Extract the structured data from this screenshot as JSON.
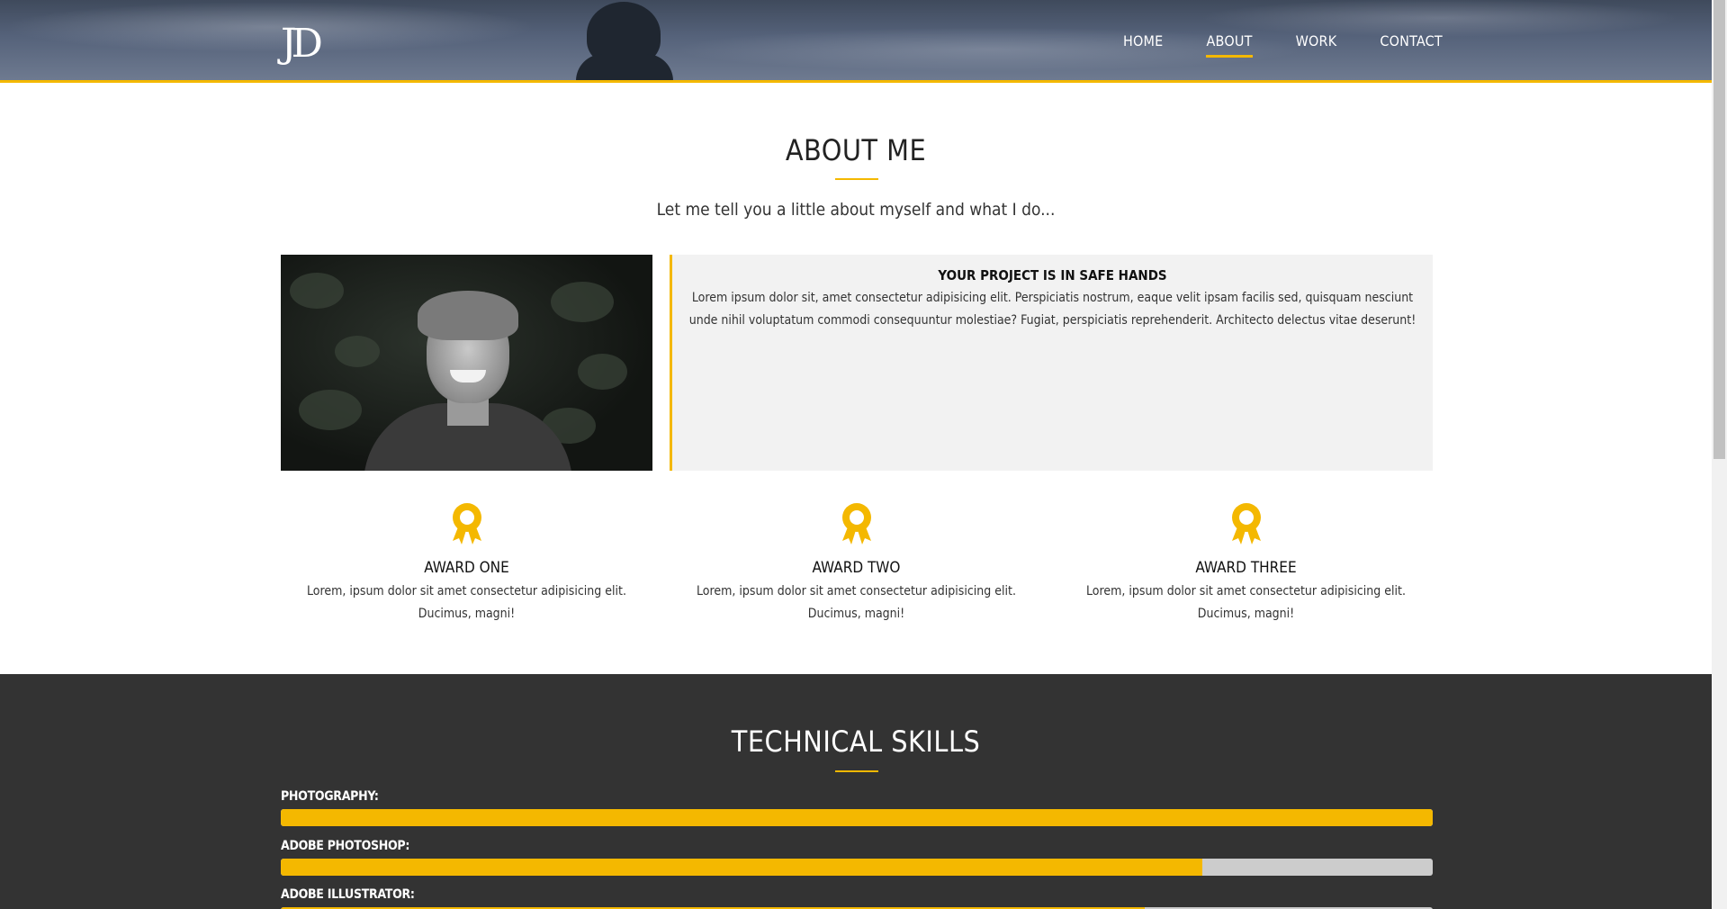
{
  "header": {
    "logo": "JD",
    "nav": [
      {
        "label": "HOME",
        "active": false
      },
      {
        "label": "ABOUT",
        "active": true
      },
      {
        "label": "WORK",
        "active": false
      },
      {
        "label": "CONTACT",
        "active": false
      }
    ]
  },
  "about": {
    "title": "ABOUT ME",
    "subtitle": "Let me tell you a little about myself and what I do...",
    "info_title": "YOUR PROJECT IS IN SAFE HANDS",
    "info_text": "Lorem ipsum dolor sit, amet consectetur adipisicing elit. Perspiciatis nostrum, eaque velit ipsam facilis sed, quisquam nesciunt unde nihil voluptatum commodi consequuntur molestiae? Fugiat, perspiciatis reprehenderit. Architecto delectus vitae deserunt!"
  },
  "awards": [
    {
      "title": "AWARD ONE",
      "text": "Lorem, ipsum dolor sit amet consectetur adipisicing elit. Ducimus, magni!",
      "icon": "award-ribbon-icon"
    },
    {
      "title": "AWARD TWO",
      "text": "Lorem, ipsum dolor sit amet consectetur adipisicing elit. Ducimus, magni!",
      "icon": "award-ribbon-icon"
    },
    {
      "title": "AWARD THREE",
      "text": "Lorem, ipsum dolor sit amet consectetur adipisicing elit. Ducimus, magni!",
      "icon": "award-ribbon-icon"
    }
  ],
  "skills": {
    "title": "TECHNICAL SKILLS",
    "items": [
      {
        "label": "PHOTOGRAPHY:",
        "percent": 100
      },
      {
        "label": "ADOBE PHOTOSHOP:",
        "percent": 80
      },
      {
        "label": "ADOBE ILLUSTRATOR:",
        "percent": 75
      }
    ]
  },
  "colors": {
    "accent": "#f4b800",
    "dark_section": "#333333",
    "info_bg": "#f2f2f2",
    "bar_track": "#cccccc"
  }
}
